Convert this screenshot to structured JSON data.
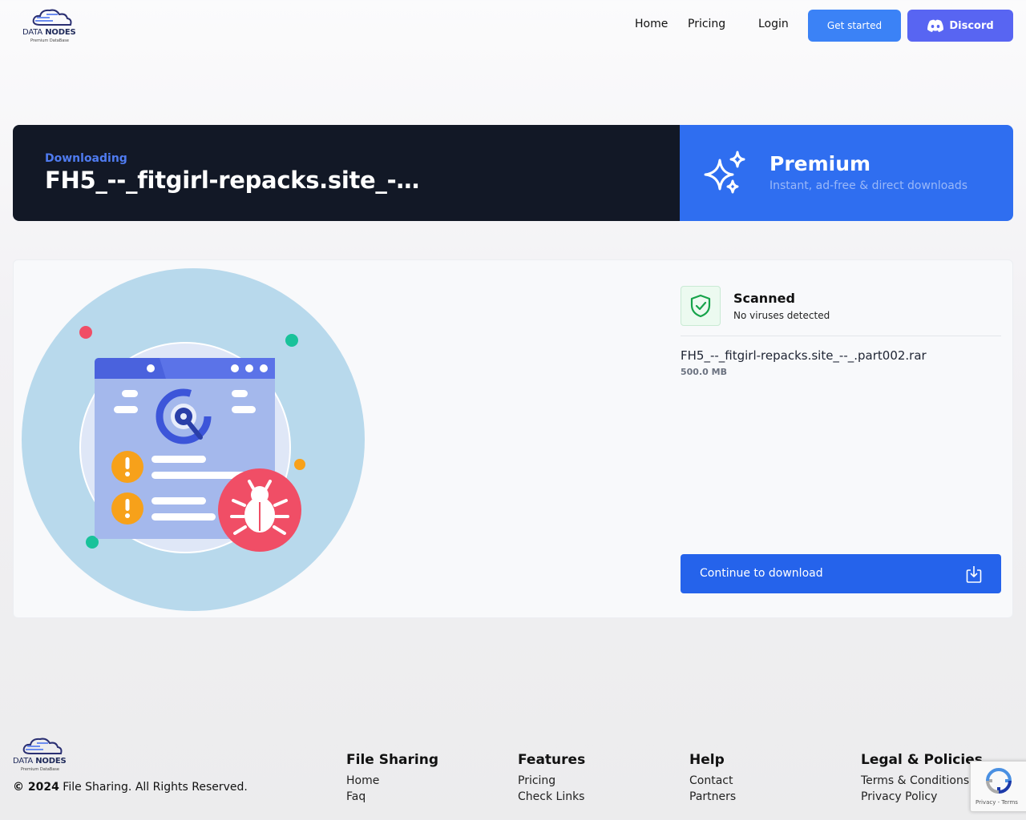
{
  "header": {
    "logo": {
      "name": "DATA",
      "name_bold": "NODES",
      "tagline": "Premium DataBase"
    },
    "nav": [
      {
        "label": "Home"
      },
      {
        "label": "Pricing"
      },
      {
        "label": "Login"
      }
    ],
    "get_started_label": "Get started",
    "discord_label": "Discord"
  },
  "banner": {
    "status_label": "Downloading",
    "file_title": "FH5_--_fitgirl-repacks.site_-…",
    "premium_title": "Premium",
    "premium_subtitle": "Instant, ad-free & direct downloads"
  },
  "file_card": {
    "scan_title": "Scanned",
    "scan_subtitle": "No viruses detected",
    "file_name": "FH5_--_fitgirl-repacks.site_--_.part002.rar",
    "file_size": "500.0 MB",
    "continue_label": "Continue to download"
  },
  "footer": {
    "copyright_year": "© 2024",
    "copyright_text": " File Sharing. All Rights Reserved.",
    "columns": [
      {
        "heading": "File Sharing",
        "links": [
          "Home",
          "Faq"
        ]
      },
      {
        "heading": "Features",
        "links": [
          "Pricing",
          "Check Links"
        ]
      },
      {
        "heading": "Help",
        "links": [
          "Contact",
          "Partners"
        ]
      },
      {
        "heading": "Legal & Policies",
        "links": [
          "Terms & Conditions",
          "Privacy Policy"
        ]
      }
    ]
  },
  "recaptcha": {
    "text": "Privacy - Terms"
  },
  "colors": {
    "brand_blue": "#3b82f6",
    "discord": "#5865f2",
    "banner_dark": "#121826",
    "premium_blue": "#2f6ef0",
    "continue_blue": "#2563eb",
    "scan_green": "#16a34a"
  },
  "icons": [
    "cloud-logo-icon",
    "discord-icon",
    "sparkles-icon",
    "shield-check-icon",
    "download-icon",
    "recaptcha-icon"
  ]
}
